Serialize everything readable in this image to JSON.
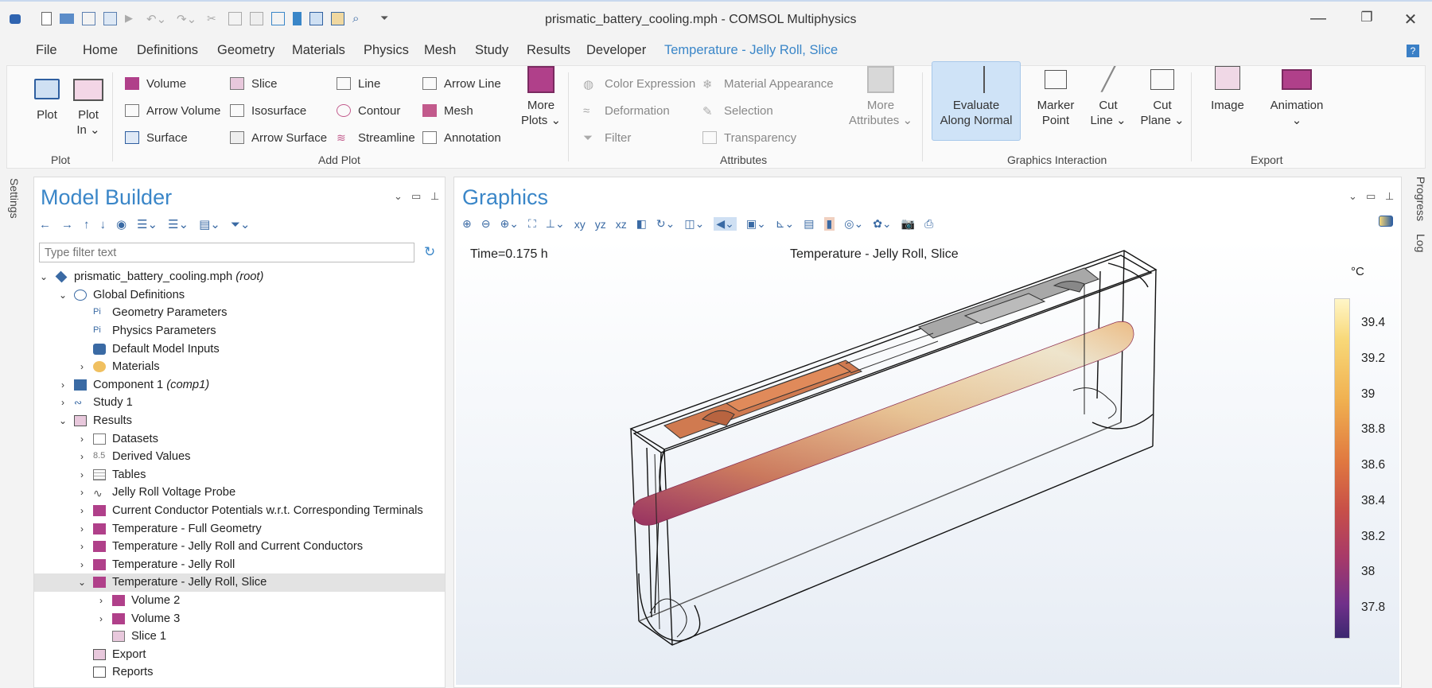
{
  "window": {
    "title": "prismatic_battery_cooling.mph - COMSOL Multiphysics"
  },
  "menu": {
    "items": [
      "File",
      "Home",
      "Definitions",
      "Geometry",
      "Materials",
      "Physics",
      "Mesh",
      "Study",
      "Results",
      "Developer"
    ],
    "active_tab": "Temperature - Jelly Roll, Slice"
  },
  "ribbon": {
    "plot": {
      "plot": "Plot",
      "plot_in": "Plot",
      "plot_in2": "In",
      "group": "Plot"
    },
    "add_plot": {
      "col1": [
        "Volume",
        "Arrow Volume",
        "Surface"
      ],
      "col2": [
        "Slice",
        "Isosurface",
        "Arrow Surface"
      ],
      "col3": [
        "Line",
        "Contour",
        "Streamline"
      ],
      "col4": [
        "Arrow Line",
        "Mesh",
        "Annotation"
      ],
      "more1": "More",
      "more2": "Plots",
      "group": "Add Plot"
    },
    "attributes": {
      "col1": [
        "Color Expression",
        "Deformation",
        "Filter"
      ],
      "col2": [
        "Material Appearance",
        "Selection",
        "Transparency"
      ],
      "more1": "More",
      "more2": "Attributes",
      "group": "Attributes"
    },
    "graphics_interaction": {
      "evaluate1": "Evaluate",
      "evaluate2": "Along Normal",
      "marker1": "Marker",
      "marker2": "Point",
      "cutline1": "Cut",
      "cutline2": "Line",
      "cutplane1": "Cut",
      "cutplane2": "Plane",
      "group": "Graphics Interaction"
    },
    "export": {
      "image": "Image",
      "animation": "Animation",
      "group": "Export"
    }
  },
  "side": {
    "settings": "Settings",
    "progress": "Progress",
    "log": "Log"
  },
  "model_builder": {
    "title": "Model Builder",
    "filter_placeholder": "Type filter text",
    "tree": [
      {
        "label": "prismatic_battery_cooling.mph",
        "suffix": "(root)"
      },
      {
        "label": "Global Definitions"
      },
      {
        "label": "Geometry Parameters"
      },
      {
        "label": "Physics Parameters"
      },
      {
        "label": "Default Model Inputs"
      },
      {
        "label": "Materials"
      },
      {
        "label": "Component 1",
        "suffix": "(comp1)"
      },
      {
        "label": "Study 1"
      },
      {
        "label": "Results"
      },
      {
        "label": "Datasets"
      },
      {
        "label": "Derived Values"
      },
      {
        "label": "Tables"
      },
      {
        "label": "Jelly Roll Voltage Probe"
      },
      {
        "label": "Current Conductor Potentials w.r.t. Corresponding Terminals"
      },
      {
        "label": "Temperature - Full Geometry"
      },
      {
        "label": "Temperature - Jelly Roll and Current Conductors"
      },
      {
        "label": "Temperature - Jelly Roll"
      },
      {
        "label": "Temperature - Jelly Roll, Slice"
      },
      {
        "label": "Volume 2"
      },
      {
        "label": "Volume 3"
      },
      {
        "label": "Slice 1"
      },
      {
        "label": "Export"
      },
      {
        "label": "Reports"
      }
    ]
  },
  "graphics": {
    "title": "Graphics",
    "time_label": "Time=0.175 h",
    "plot_title": "Temperature - Jelly Roll, Slice",
    "unit": "°C",
    "colorbar_ticks": [
      "39.4",
      "39.2",
      "39",
      "38.8",
      "38.6",
      "38.4",
      "38.2",
      "38",
      "37.8"
    ],
    "colors": {
      "hot": "#fff6c8",
      "mid": "#e07840",
      "cold": "#3c2870",
      "accent": "#3a86c8"
    }
  }
}
